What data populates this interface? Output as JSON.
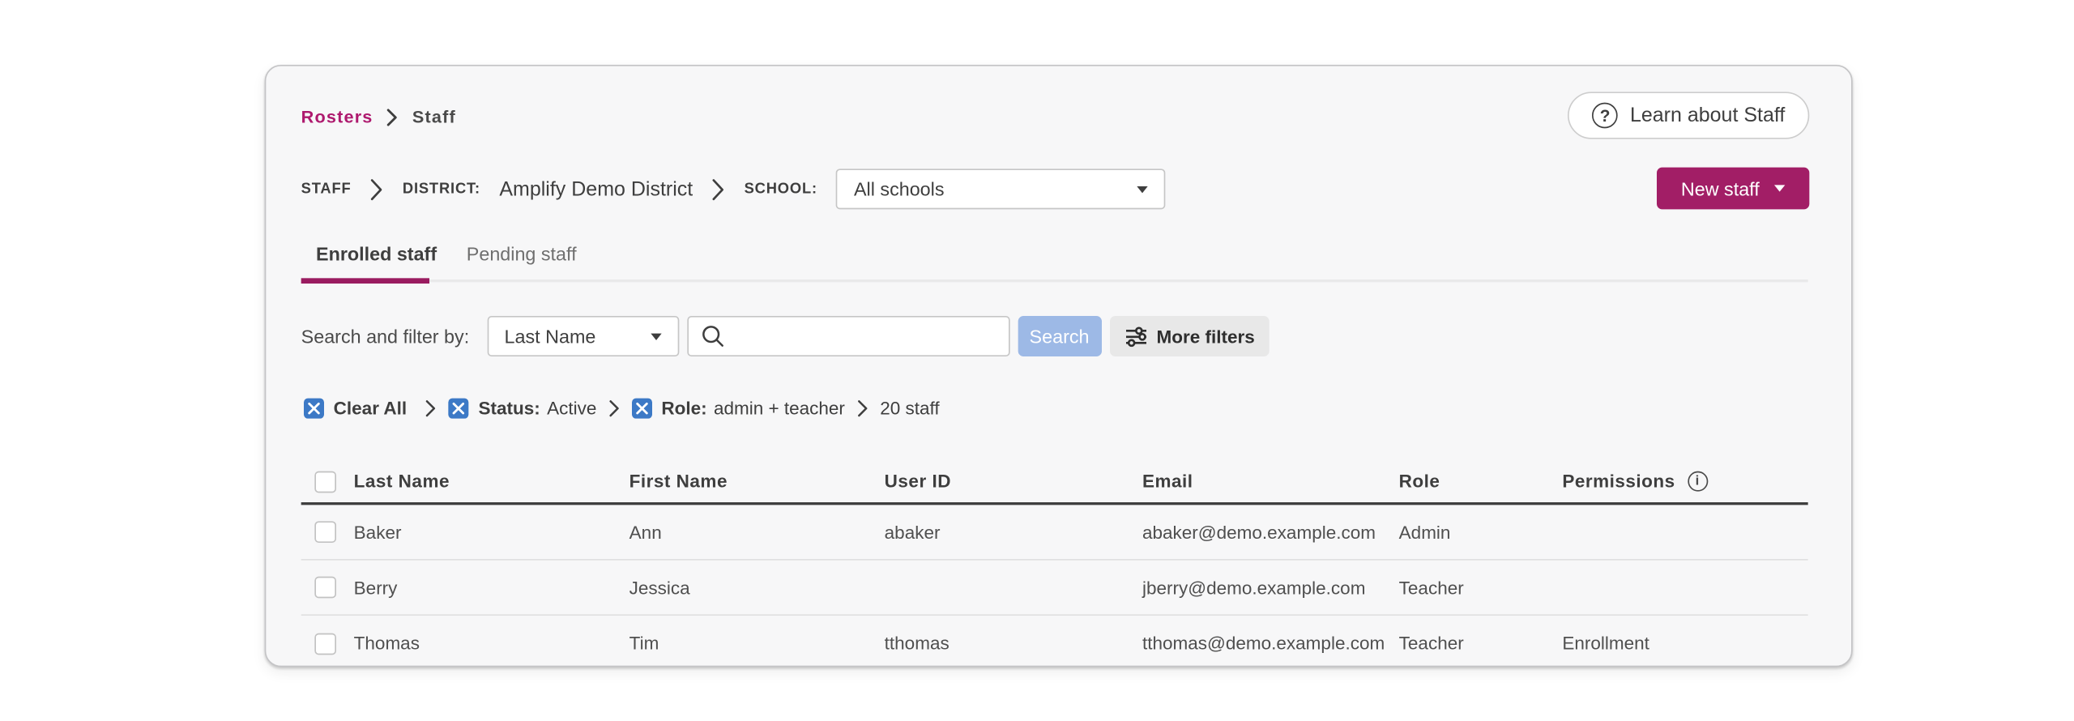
{
  "breadcrumb": {
    "rosters": "Rosters",
    "staff": "Staff"
  },
  "learn_button": {
    "label": "Learn about Staff"
  },
  "context_bar": {
    "staff_label": "STAFF",
    "district_label": "DISTRICT:",
    "district_value": "Amplify Demo District",
    "school_label": "SCHOOL:",
    "school_value": "All schools"
  },
  "new_staff_button": {
    "label": "New staff"
  },
  "tabs": {
    "enrolled": "Enrolled staff",
    "pending": "Pending staff"
  },
  "search": {
    "label": "Search and filter by:",
    "selected_field": "Last Name",
    "query": "",
    "search_button": "Search",
    "more_filters_button": "More filters"
  },
  "filters": {
    "clear_all": "Clear All",
    "status_label": "Status:",
    "status_value": "Active",
    "role_label": "Role:",
    "role_value": "admin + teacher",
    "result_count": "20 staff"
  },
  "table": {
    "columns": [
      "Last Name",
      "First Name",
      "User ID",
      "Email",
      "Role",
      "Permissions"
    ],
    "rows": [
      {
        "last_name": "Baker",
        "first_name": "Ann",
        "user_id": "abaker",
        "email": "abaker@demo.example.com",
        "role": "Admin",
        "permissions": ""
      },
      {
        "last_name": "Berry",
        "first_name": "Jessica",
        "user_id": "",
        "email": "jberry@demo.example.com",
        "role": "Teacher",
        "permissions": ""
      },
      {
        "last_name": "Thomas",
        "first_name": "Tim",
        "user_id": "tthomas",
        "email": "tthomas@demo.example.com",
        "role": "Teacher",
        "permissions": "Enrollment"
      }
    ]
  },
  "colors": {
    "brand_magenta": "#A21E66",
    "link_magenta": "#AE196E",
    "tab_underline": "#9A1B60",
    "chip_blue": "#3C79C6",
    "search_button_blue": "#9DB9E6",
    "card_background": "#F7F7F8"
  }
}
